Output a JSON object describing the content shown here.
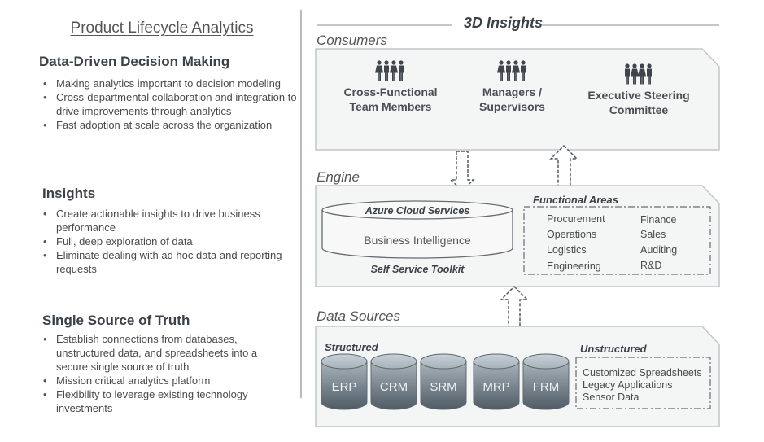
{
  "left": {
    "title": "Product Lifecycle Analytics",
    "sections": [
      {
        "heading": "Data-Driven Decision Making",
        "bullets": [
          "Making analytics important to decision modeling",
          "Cross-departmental collaboration and integration to drive improvements through analytics",
          "Fast adoption at scale across the organization"
        ]
      },
      {
        "heading": "Insights",
        "bullets": [
          "Create actionable insights to drive business performance",
          "Full, deep exploration of data",
          "Eliminate dealing with ad hoc data and reporting requests"
        ]
      },
      {
        "heading": "Single Source of Truth",
        "bullets": [
          "Establish connections from databases, unstructured data, and spreadsheets into a secure single source of truth",
          "Mission critical analytics platform",
          "Flexibility to leverage existing technology investments"
        ]
      }
    ]
  },
  "right": {
    "title": "3D Insights",
    "consumers": {
      "label": "Consumers",
      "groups": [
        {
          "line1": "Cross-Functional",
          "line2": "Team Members",
          "icon": "people-group-icon"
        },
        {
          "line1": "Managers /",
          "line2": "Supervisors",
          "icon": "people-group-icon"
        },
        {
          "line1": "Executive Steering",
          "line2": "Committee",
          "icon": "people-group-icon"
        }
      ]
    },
    "engine": {
      "label": "Engine",
      "platform_top": "Azure Cloud Services",
      "platform_body": "Business Intelligence",
      "platform_caption": "Self Service Toolkit",
      "functional_areas_title": "Functional Areas",
      "functional_areas": [
        [
          "Procurement",
          "Finance"
        ],
        [
          "Operations",
          "Sales"
        ],
        [
          "Logistics",
          "Auditing"
        ],
        [
          "Engineering",
          "R&D"
        ]
      ]
    },
    "data_sources": {
      "label": "Data Sources",
      "structured_title": "Structured",
      "structured": [
        "ERP",
        "CRM",
        "SRM",
        "MRP",
        "FRM"
      ],
      "unstructured_title": "Unstructured",
      "unstructured": [
        "Customized Spreadsheets",
        "Legacy Applications",
        "Sensor Data"
      ]
    },
    "flows": [
      {
        "from": "consumers",
        "to": "engine",
        "direction": "down"
      },
      {
        "from": "engine",
        "to": "consumers",
        "direction": "up"
      },
      {
        "from": "data_sources",
        "to": "engine",
        "direction": "up"
      }
    ]
  },
  "colors": {
    "panel_fill": "#f4f5f5",
    "panel_stroke": "#c2c6c9",
    "db_top": "#b7c1c8",
    "db_bottom": "#56636d",
    "heading": "#3a4148",
    "divider": "#b8bcbf"
  }
}
